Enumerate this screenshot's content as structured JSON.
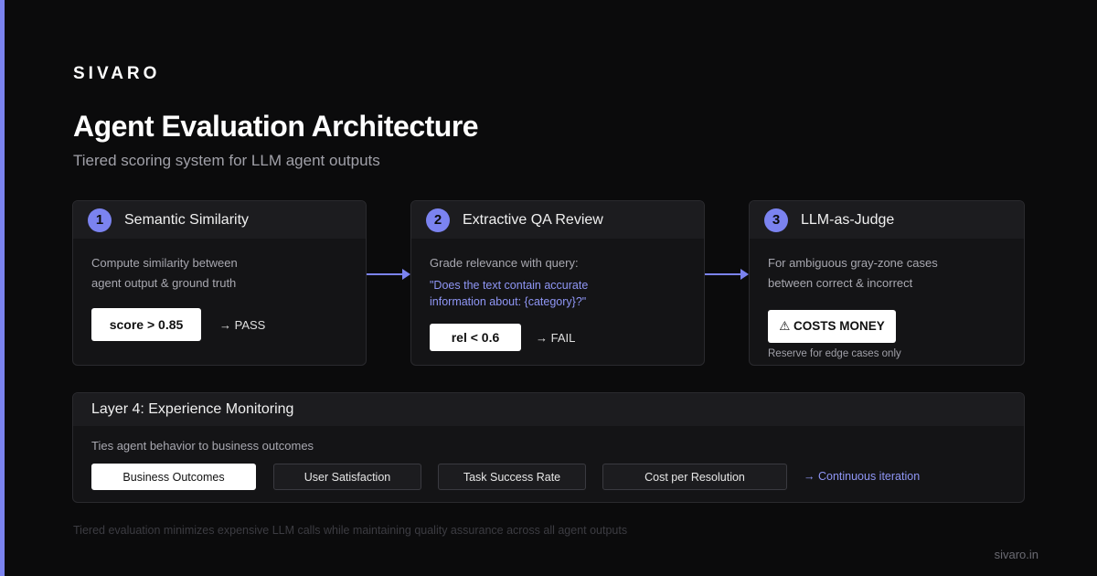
{
  "brand": "SIVARO",
  "title": "Agent Evaluation Architecture",
  "subtitle": "Tiered scoring system for LLM agent outputs",
  "colors": {
    "accent": "#7b83f0",
    "background": "#0b0b0c",
    "card": "#141416"
  },
  "tiers": [
    {
      "number": "1",
      "title": "Semantic Similarity",
      "desc_lines": [
        "Compute similarity between",
        "agent output & ground truth"
      ],
      "threshold": "score > 0.85",
      "outcome": "→ PASS"
    },
    {
      "number": "2",
      "title": "Extractive QA Review",
      "desc_lines": [
        "Grade relevance with query:"
      ],
      "quote_lines": [
        "\"Does the text contain accurate",
        "information about: {category}?\""
      ],
      "threshold": "rel < 0.6",
      "outcome": "→ FAIL"
    },
    {
      "number": "3",
      "title": "LLM-as-Judge",
      "desc_lines": [
        "For ambiguous gray-zone cases",
        "between correct & incorrect"
      ],
      "badge": "⚠ COSTS MONEY",
      "note": "Reserve for edge cases only"
    }
  ],
  "layer4": {
    "title": "Layer 4: Experience Monitoring",
    "desc": "Ties agent behavior to business outcomes",
    "metrics": [
      "Business Outcomes",
      "User Satisfaction",
      "Task Success Rate",
      "Cost per Resolution"
    ],
    "iteration": "→ Continuous iteration"
  },
  "footer": "Tiered evaluation minimizes expensive LLM calls while maintaining quality assurance across all agent outputs",
  "site": "sivaro.in"
}
